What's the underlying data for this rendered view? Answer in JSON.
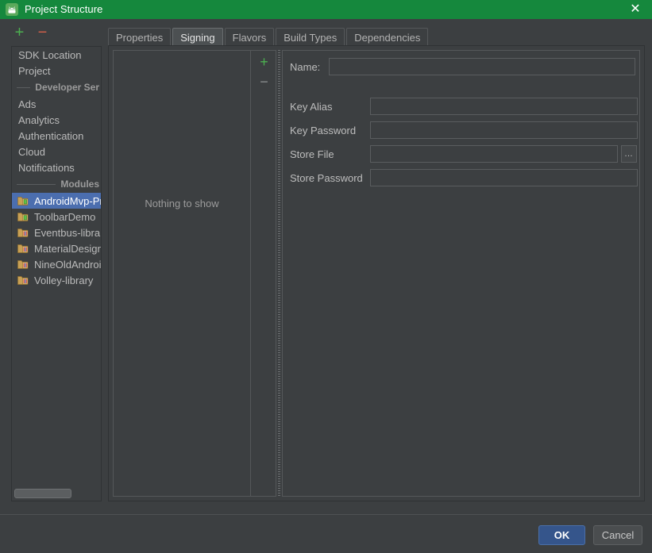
{
  "window": {
    "title": "Project Structure",
    "app_icon": "android-studio-icon",
    "close_label": "✕",
    "titlebar_color": "#15883d"
  },
  "toolbar": {
    "add_label": "+",
    "remove_label": "−",
    "add_color": "#4caf50",
    "remove_color": "#d4604a"
  },
  "sidebar": {
    "nav_items": [
      {
        "label": "SDK Location"
      },
      {
        "label": "Project"
      }
    ],
    "developer_services_header": "Developer Ser",
    "service_items": [
      {
        "label": "Ads"
      },
      {
        "label": "Analytics"
      },
      {
        "label": "Authentication"
      },
      {
        "label": "Cloud"
      },
      {
        "label": "Notifications"
      }
    ],
    "modules_header": "Modules",
    "modules": [
      {
        "label": "AndroidMvp-Pr",
        "icon": "module-app-icon",
        "selected": true
      },
      {
        "label": "ToolbarDemo",
        "icon": "module-app-icon",
        "selected": false
      },
      {
        "label": "Eventbus-librar",
        "icon": "module-library-icon",
        "selected": false
      },
      {
        "label": "MaterialDesign",
        "icon": "module-library-icon",
        "selected": false
      },
      {
        "label": "NineOldAndroi",
        "icon": "module-library-icon",
        "selected": false
      },
      {
        "label": "Volley-library",
        "icon": "module-library-icon",
        "selected": false
      }
    ],
    "selection_color": "#4b6eaf"
  },
  "tabs": [
    {
      "label": "Properties",
      "active": false
    },
    {
      "label": "Signing",
      "active": true
    },
    {
      "label": "Flavors",
      "active": false
    },
    {
      "label": "Build Types",
      "active": false
    },
    {
      "label": "Dependencies",
      "active": false
    }
  ],
  "signing_list": {
    "empty_message": "Nothing to show",
    "add_label": "+",
    "remove_label": "−"
  },
  "form": {
    "name": {
      "label": "Name:",
      "value": "",
      "placeholder": ""
    },
    "key_alias": {
      "label": "Key Alias",
      "value": "",
      "placeholder": ""
    },
    "key_password": {
      "label": "Key Password",
      "value": "",
      "placeholder": ""
    },
    "store_file": {
      "label": "Store File",
      "value": "",
      "placeholder": "",
      "browse_label": "…"
    },
    "store_password": {
      "label": "Store Password",
      "value": "",
      "placeholder": ""
    }
  },
  "footer": {
    "ok_label": "OK",
    "cancel_label": "Cancel"
  }
}
